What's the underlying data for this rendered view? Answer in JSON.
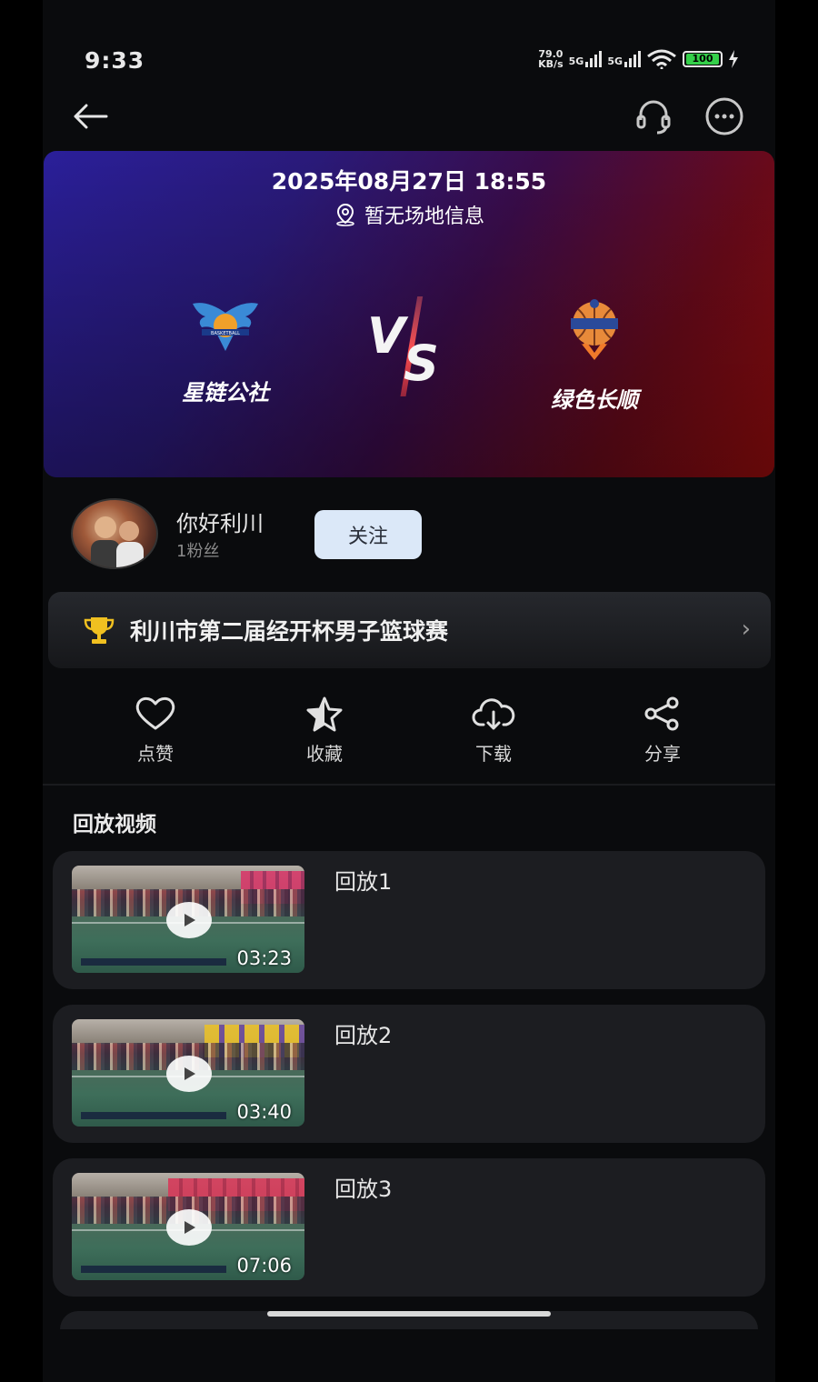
{
  "status_bar": {
    "time": "9:33",
    "net_speed_value": "79.0",
    "net_speed_unit": "KB/s",
    "sim1": "5G",
    "sim2": "5G",
    "battery": "100"
  },
  "match": {
    "datetime": "2025年08月27日 18:55",
    "venue": "暂无场地信息",
    "vs_label": "VS",
    "home_team": "星链公社",
    "away_team": "绿色长顺",
    "home_logo_text": "BASKETBALL"
  },
  "uploader": {
    "name": "你好利川",
    "fans": "1粉丝",
    "follow_label": "关注"
  },
  "tournament": {
    "title": "利川市第二届经开杯男子篮球赛"
  },
  "actions": [
    {
      "label": "点赞",
      "icon": "heart-icon"
    },
    {
      "label": "收藏",
      "icon": "star-icon"
    },
    {
      "label": "下载",
      "icon": "cloud-download-icon"
    },
    {
      "label": "分享",
      "icon": "share-icon"
    }
  ],
  "replays": {
    "section_title": "回放视频",
    "items": [
      {
        "title": "回放1",
        "duration": "03:23"
      },
      {
        "title": "回放2",
        "duration": "03:40"
      },
      {
        "title": "回放3",
        "duration": "07:06"
      }
    ]
  },
  "colors": {
    "background": "#0a0b0d",
    "card": "#1c1d21",
    "follow_button": "#dbe8f8",
    "banner_left": "#2a1f9a",
    "banner_right": "#9a0c0c",
    "trophy": "#f0c020"
  }
}
